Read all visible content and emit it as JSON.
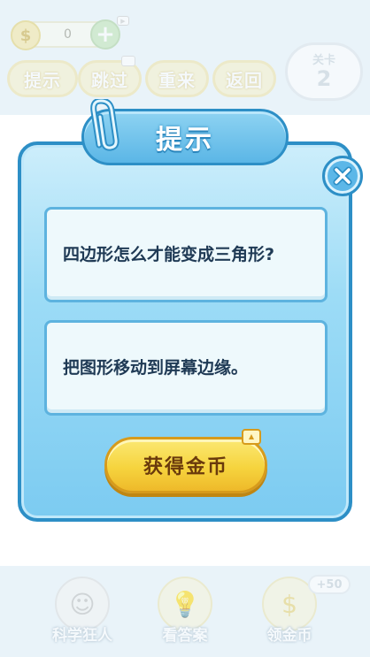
{
  "top": {
    "coin_count": "0",
    "buttons": [
      "提示",
      "跳过",
      "重来",
      "返回"
    ],
    "level_label": "关卡",
    "level_number": "2"
  },
  "dialog": {
    "title": "提示",
    "question": "四边形怎么才能变成三角形?",
    "hint": "把图形移动到屏幕边缘。",
    "action_label": "获得金币"
  },
  "bottom": {
    "items": [
      "科学狂人",
      "看答案",
      "领金币"
    ],
    "bonus": "+50"
  },
  "colors": {
    "dialog_border": "#2d8fc6",
    "dialog_fill": "#9ddcf6",
    "button_gold": "#f6d43e"
  }
}
